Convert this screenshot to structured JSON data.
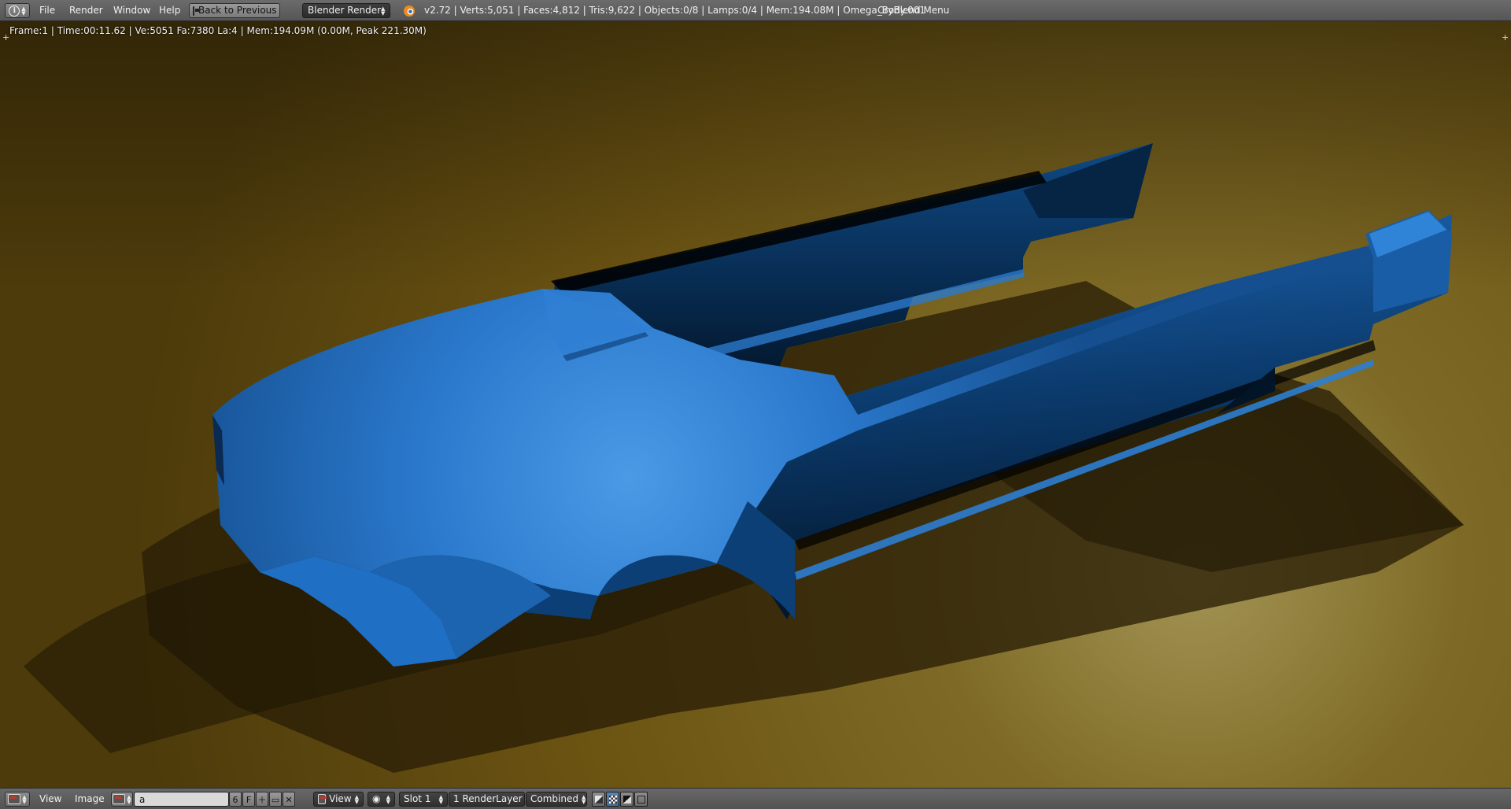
{
  "header": {
    "editor_icon": "info-icon",
    "menus": [
      "File",
      "Render",
      "Window",
      "Help"
    ],
    "back_button": "Back to Previous",
    "render_engine": "Blender Render",
    "logo_icon": "blender-logo",
    "stats": "v2.72 | Verts:5,051 | Faces:4,812 | Tris:9,622 | Objects:0/8 | Lamps:0/4 | Mem:194.08M | Omega_Body.001",
    "cryblend_menu": "CryBlend Menu"
  },
  "viewport": {
    "render_info": "Frame:1 | Time:00:11.62 | Ve:5051 Fa:7380 La:4 | Mem:194.09M (0.00M, Peak 221.30M)",
    "corner_mark": "+",
    "colors": {
      "background": "#6b5312",
      "background_light": "#a39454",
      "body": "#1f6fc4",
      "body_dark": "#06264a",
      "shadow": "#2a1f06"
    }
  },
  "footer": {
    "editor_icon": "image-editor-icon",
    "view_menu": "View",
    "image_menu": "Image",
    "image_name": "a",
    "users_count": "6",
    "fake_user": "F",
    "new_icon": "plus-icon",
    "open_icon": "folder-icon",
    "unlink_icon": "close-icon",
    "view_select": "View",
    "slot_select": "Slot 1",
    "render_layer_select": "1 RenderLayer",
    "pass_select": "Combined"
  }
}
